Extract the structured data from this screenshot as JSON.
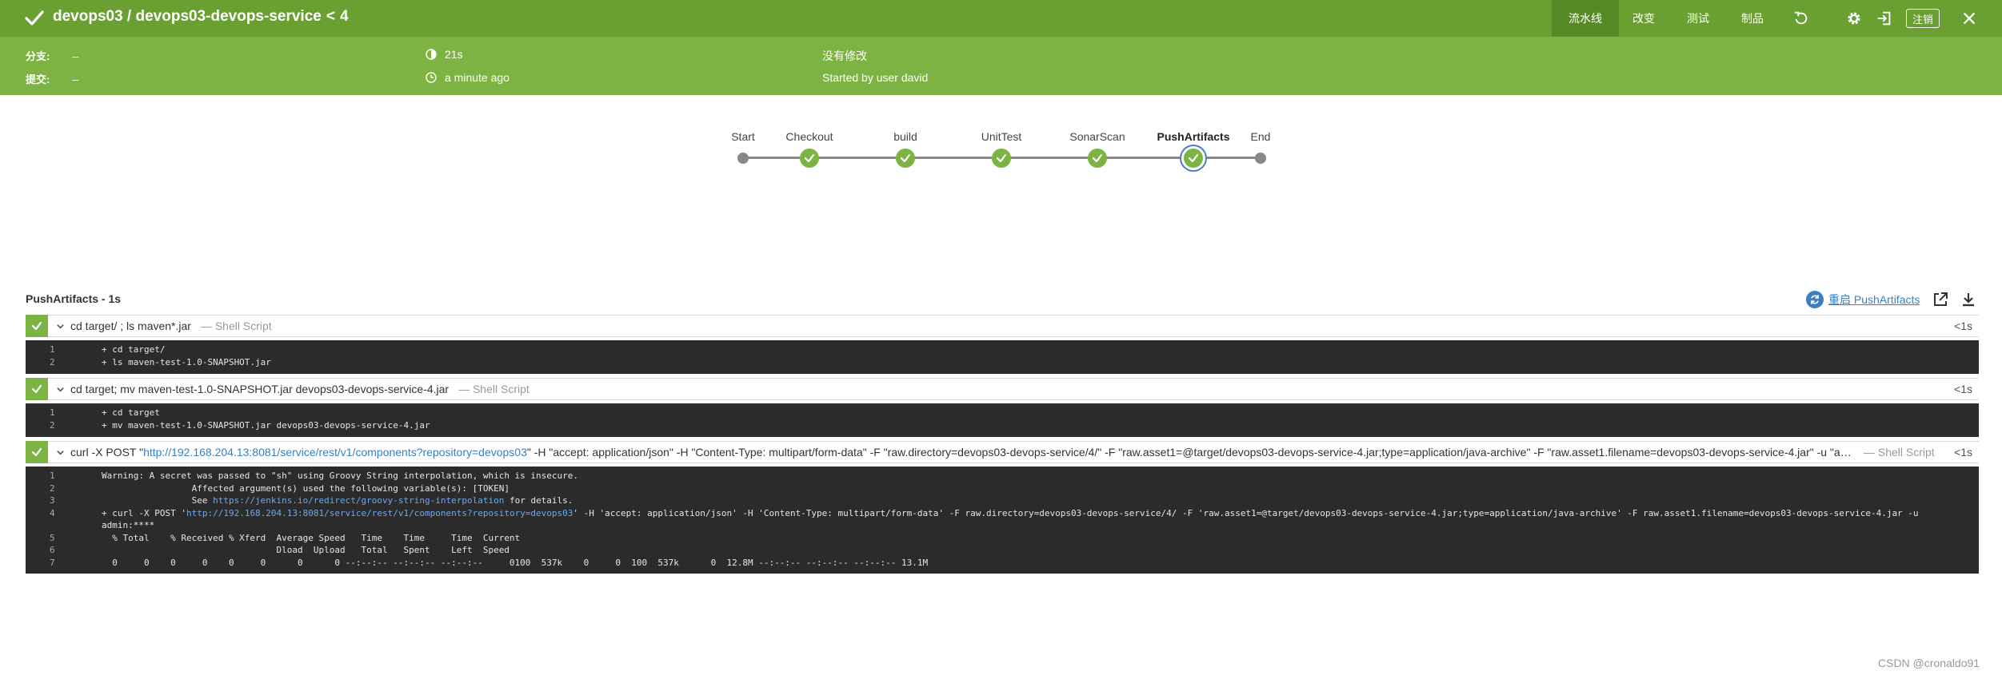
{
  "header": {
    "title": "devops03 / devops03-devops-service",
    "run_separator": "<",
    "run_number": "4",
    "nav": {
      "pipeline": "流水线",
      "changes": "改变",
      "tests": "测试",
      "artifacts": "制品",
      "logout": "注销"
    },
    "icons": [
      "rerun-icon",
      "settings-icon",
      "open-classic-icon",
      "close-icon"
    ],
    "colors": {
      "bar": "#6aa032",
      "active_tab": "#558a26",
      "info_bar": "#7cb342"
    }
  },
  "info": {
    "branch_label": "分支:",
    "branch_value": "–",
    "commit_label": "提交:",
    "commit_value": "–",
    "duration": "21s",
    "started": "a minute ago",
    "changes": "没有修改",
    "started_by": "Started by user david"
  },
  "pipeline": {
    "stages": [
      {
        "name": "Start",
        "kind": "terminal"
      },
      {
        "name": "Checkout",
        "kind": "success"
      },
      {
        "name": "build",
        "kind": "success"
      },
      {
        "name": "UnitTest",
        "kind": "success"
      },
      {
        "name": "SonarScan",
        "kind": "success"
      },
      {
        "name": "PushArtifacts",
        "kind": "success",
        "selected": true
      },
      {
        "name": "End",
        "kind": "terminal"
      }
    ]
  },
  "log_panel": {
    "title": "PushArtifacts - 1s",
    "restart_label": "重启 PushArtifacts",
    "steps": [
      {
        "command": "cd target/ ; ls maven*.jar",
        "kind": "— Shell Script",
        "duration": "<1s",
        "lines": [
          {
            "n": "1",
            "text": "+ cd target/"
          },
          {
            "n": "2",
            "text": "+ ls maven-test-1.0-SNAPSHOT.jar"
          }
        ]
      },
      {
        "command": "cd target; mv maven-test-1.0-SNAPSHOT.jar devops03-devops-service-4.jar",
        "kind": "— Shell Script",
        "duration": "<1s",
        "lines": [
          {
            "n": "1",
            "text": "+ cd target"
          },
          {
            "n": "2",
            "text": "+ mv maven-test-1.0-SNAPSHOT.jar devops03-devops-service-4.jar"
          }
        ]
      },
      {
        "command_prefix": "curl -X POST \"",
        "command_link": "http://192.168.204.13:8081/service/rest/v1/components?repository=devops03",
        "command_suffix": "\" -H \"accept: application/json\" -H \"Content-Type: multipart/form-data\" -F \"raw.directory=devops03-devops-service/4/\" -F \"raw.asset1=@target/devops03-devops-service-4.jar;type=application/java-archive\" -F \"raw.asset1.filename=devops03-devops-service-4.jar\" -u \"ad...",
        "kind": "— Shell Script",
        "duration": "<1s",
        "lines": [
          {
            "n": "1",
            "text": "Warning: A secret was passed to \"sh\" using Groovy String interpolation, which is insecure."
          },
          {
            "n": "2",
            "text": "                 Affected argument(s) used the following variable(s): [TOKEN]"
          },
          {
            "n": "3",
            "text_prefix": "                 See ",
            "link": "https://jenkins.io/redirect/groovy-string-interpolation",
            "text_suffix": " for details."
          },
          {
            "n": "4",
            "text_prefix": "+ curl -X POST '",
            "link": "http://192.168.204.13:8081/service/rest/v1/components?repository=devops03",
            "text_suffix": "' -H 'accept: application/json' -H 'Content-Type: multipart/form-data' -F raw.directory=devops03-devops-service/4/ -F 'raw.asset1=@target/devops03-devops-service-4.jar;type=application/java-archive' -F raw.asset1.filename=devops03-devops-service-4.jar -u"
          },
          {
            "n": "",
            "text": "admin:****"
          },
          {
            "n": "5",
            "text": "  % Total    % Received % Xferd  Average Speed   Time    Time     Time  Current"
          },
          {
            "n": "6",
            "text": "                                 Dload  Upload   Total   Spent    Left  Speed"
          },
          {
            "n": "7",
            "text": "  0     0    0     0    0     0      0      0 --:--:-- --:--:-- --:--:--     0100  537k    0     0  100  537k      0  12.8M --:--:-- --:--:-- --:--:-- 13.1M"
          }
        ]
      }
    ]
  },
  "watermark": "CSDN @cronaldo91"
}
